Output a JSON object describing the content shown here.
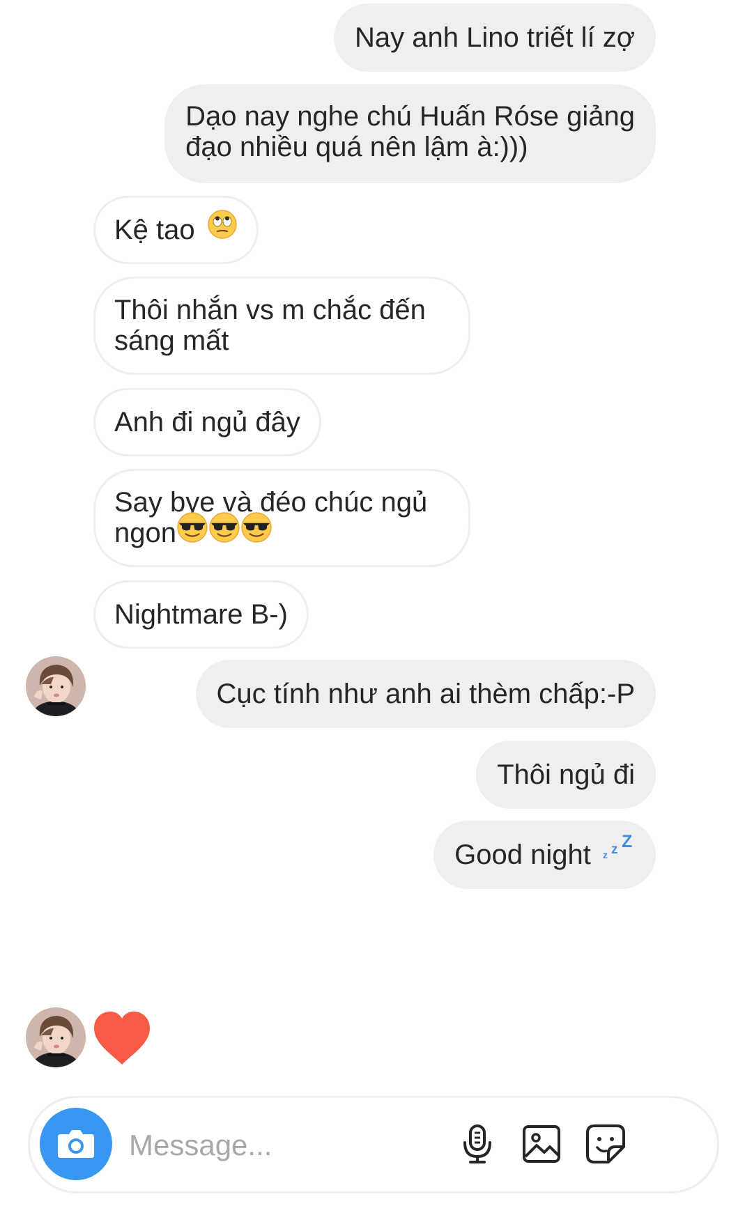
{
  "messages": [
    {
      "direction": "outgoing",
      "lines": [
        "Nay anh Lino triết lí zợ"
      ]
    },
    {
      "direction": "outgoing",
      "lines": [
        "Dạo nay nghe chú Huấn Róse giảng",
        "đạo nhiều quá nên lậm à:)))"
      ]
    },
    {
      "direction": "incoming",
      "text": "Kệ tao",
      "emoji": "face-with-rolling-eyes"
    },
    {
      "direction": "incoming",
      "lines": [
        "Thôi nhắn vs m chắc đến",
        "sáng mất"
      ]
    },
    {
      "direction": "incoming",
      "text": "Anh đi ngủ đây"
    },
    {
      "direction": "incoming",
      "lines": [
        "Say bye và đéo chúc ngủ",
        "ngon"
      ],
      "emoji": "smiling-face-with-sunglasses",
      "emoji_count": 3
    },
    {
      "direction": "incoming",
      "text": "Nightmare B-)",
      "avatar": "sender-avatar"
    },
    {
      "direction": "outgoing",
      "text": "Cục tính như anh ai thèm chấp:-P"
    },
    {
      "direction": "outgoing",
      "text": "Thôi ngủ đi"
    },
    {
      "direction": "outgoing",
      "text": "Good night",
      "emoji": "sleeping-zzz"
    },
    {
      "direction": "incoming",
      "reaction": "heart",
      "avatar": "sender-avatar"
    }
  ],
  "composer": {
    "placeholder": "Message...",
    "icons": [
      "camera-icon",
      "microphone-icon",
      "gallery-icon",
      "sticker-icon"
    ]
  },
  "colors": {
    "outgoing_bubble": "#efefef",
    "incoming_border": "#efefef",
    "camera_button": "#3897f0",
    "heart": "#f75a46",
    "placeholder_text": "#a8a8a8"
  }
}
